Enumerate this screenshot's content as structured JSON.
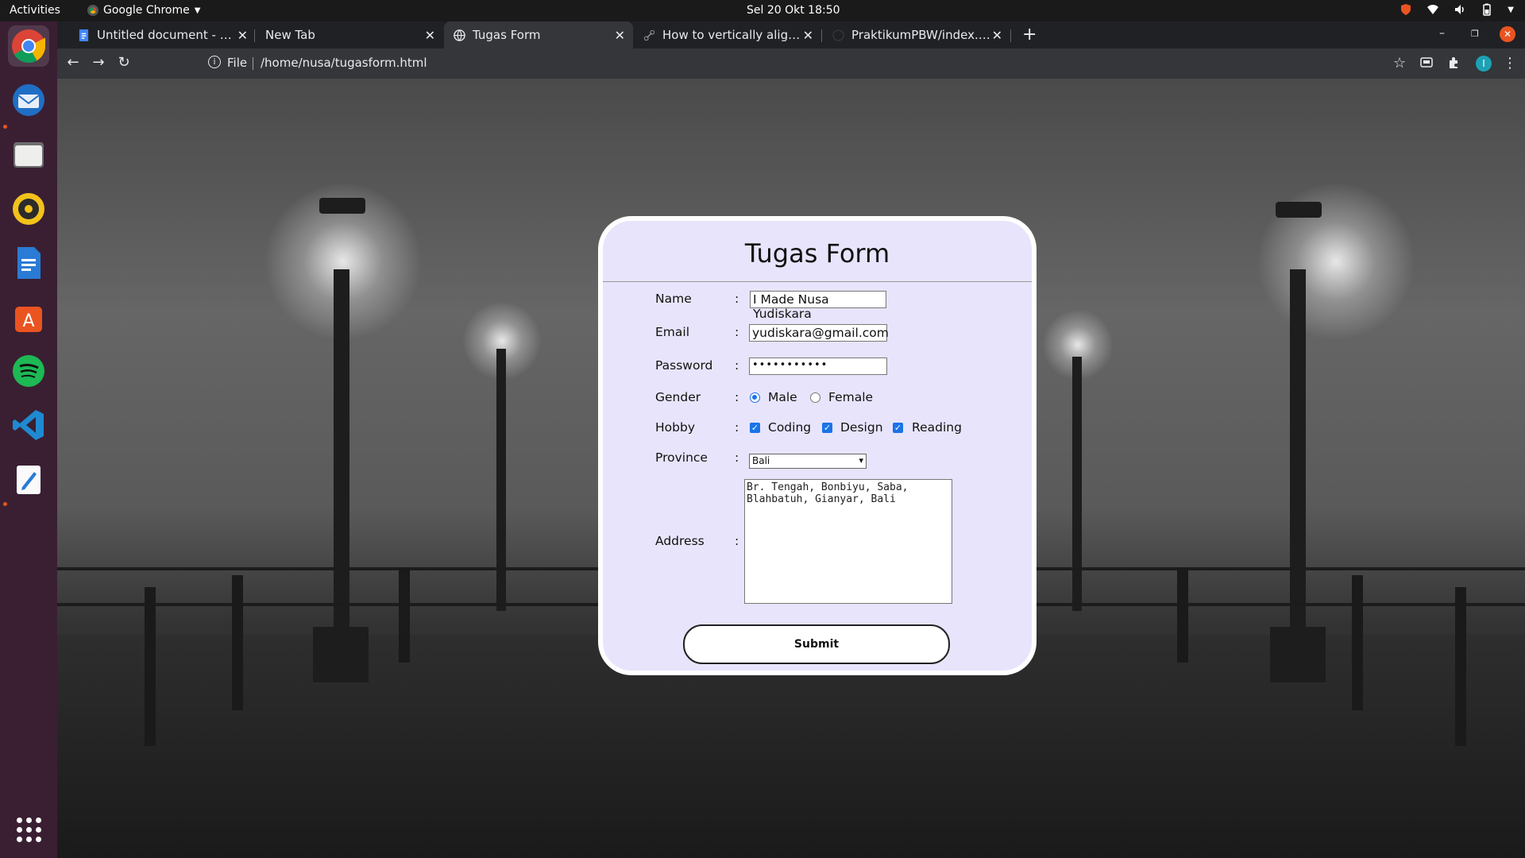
{
  "topbar": {
    "activities": "Activities",
    "app_name": "Google Chrome",
    "clock": "Sel 20 Okt  18:50"
  },
  "dock": {
    "items": [
      "google-chrome",
      "thunderbird",
      "files",
      "rhythmbox",
      "libreoffice-writer",
      "ubuntu-software",
      "spotify",
      "visual-studio-code",
      "text-editor"
    ]
  },
  "browser": {
    "tabs": [
      {
        "title": "Untitled document - Goog",
        "icon": "docs-icon"
      },
      {
        "title": "New Tab",
        "icon": ""
      },
      {
        "title": "Tugas Form",
        "icon": "globe-icon",
        "active": true
      },
      {
        "title": "How to vertically align a \"",
        "icon": "link-icon"
      },
      {
        "title": "PraktikumPBW/index.htm",
        "icon": "github-icon"
      }
    ],
    "address_scheme": "File",
    "address_url": "/home/nusa/tugasform.html",
    "profile_initial": "I"
  },
  "form": {
    "title": "Tugas Form",
    "name_label": "Name",
    "name_value": "I Made Nusa Yudiskara",
    "email_label": "Email",
    "email_value": "yudiskara@gmail.com",
    "password_label": "Password",
    "password_value": "•••••••••••",
    "gender_label": "Gender",
    "gender_male": "Male",
    "gender_female": "Female",
    "gender_selected": "Male",
    "hobby_label": "Hobby",
    "hobby_coding": "Coding",
    "hobby_design": "Design",
    "hobby_reading": "Reading",
    "province_label": "Province",
    "province_value": "Bali",
    "address_label": "Address",
    "address_value": "Br. Tengah, Bonbiyu, Saba,\nBlahbatuh, Gianyar, Bali",
    "colon": ":",
    "submit_label": "Submit"
  },
  "colors": {
    "card_background": "#e8e4fb",
    "accent": "#1a73e8",
    "chrome_dark": "#35363a",
    "dock_background": "#3a1f33"
  }
}
